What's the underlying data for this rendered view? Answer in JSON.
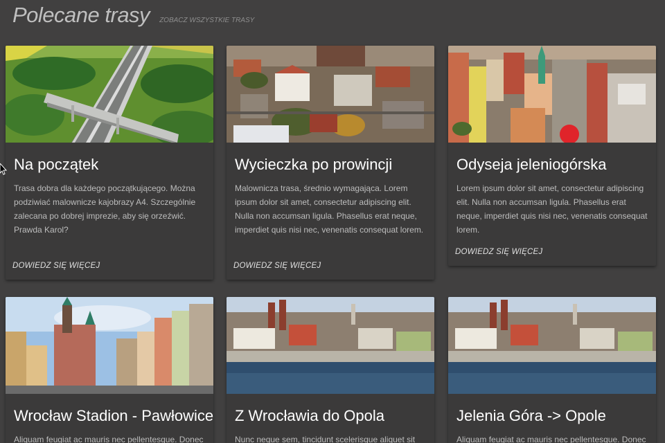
{
  "header": {
    "title": "Polecane trasy",
    "link": "ZOBACZ WSZYSTKIE TRASY"
  },
  "cards": [
    {
      "title": "Na początek",
      "description": "Trasa dobra dla każdego początkującego. Można podziwiać malownicze kajobrazy A4. Szczególnie zalecana po dobrej imprezie, aby się orzeźwić. Prawda Karol?",
      "action": "DOWIEDZ SIĘ WIĘCEJ",
      "image": "highway-bridge-aerial"
    },
    {
      "title": "Wycieczka po prowincji",
      "description": "Malownicza trasa, średnio wymagająca. Lorem ipsum dolor sit amet, consectetur adipiscing elit. Nulla non accumsan ligula. Phasellus erat neque, imperdiet quis nisi nec, venenatis consequat lorem.",
      "action": "DOWIEDZ SIĘ WIĘCEJ",
      "image": "town-aerial"
    },
    {
      "title": "Odyseja jeleniogórska",
      "description": "Lorem ipsum dolor sit amet, consectetur adipiscing elit. Nulla non accumsan ligula. Phasellus erat neque, imperdiet quis nisi nec, venenatis consequat lorem.",
      "action": "DOWIEDZ SIĘ WIĘCEJ",
      "image": "old-town-square-aerial"
    },
    {
      "title": "Wrocław Stadion - Pawłowice",
      "description": "Aliquam feugiat ac mauris nec pellentesque. Donec",
      "action": "",
      "image": "wroclaw-market-square"
    },
    {
      "title": "Z Wrocławia do Opola",
      "description": "Nunc neque sem, tincidunt scelerisque aliquet sit",
      "action": "",
      "image": "opole-riverside"
    },
    {
      "title": "Jelenia Góra -> Opole",
      "description": "Aliquam feugiat ac mauris nec pellentesque. Donec",
      "action": "",
      "image": "opole-riverside"
    }
  ]
}
